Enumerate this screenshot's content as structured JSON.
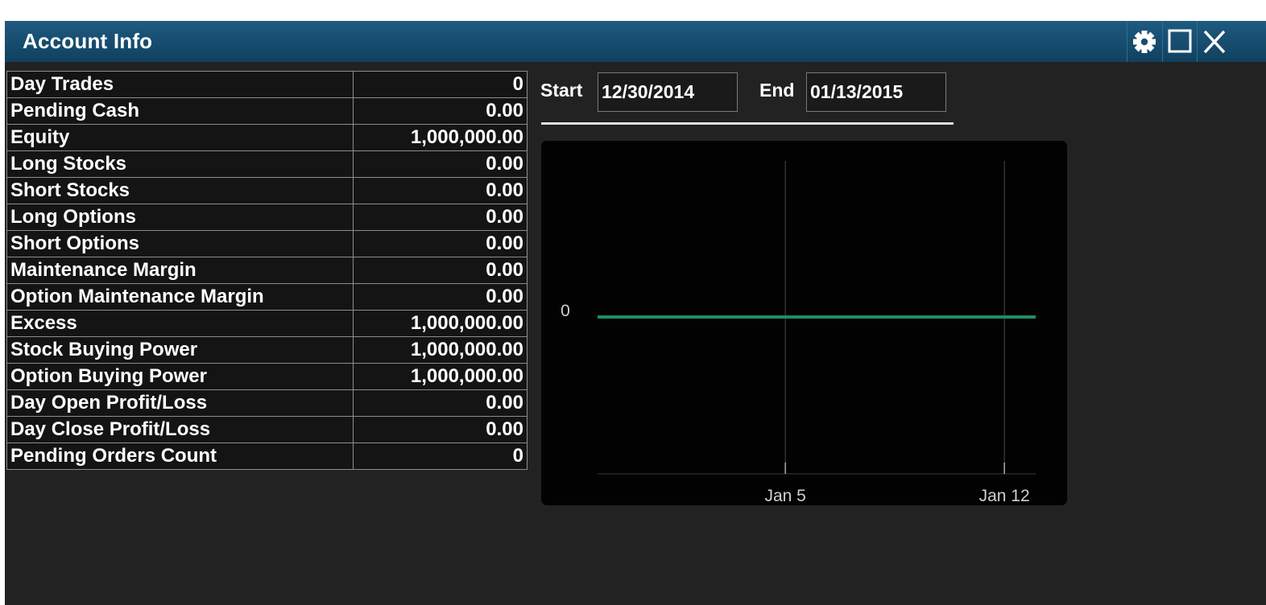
{
  "window": {
    "title": "Account Info",
    "controls": [
      {
        "name": "settings-gear-icon",
        "icon": "gear"
      },
      {
        "name": "maximize-icon",
        "icon": "square"
      },
      {
        "name": "close-icon",
        "icon": "x"
      }
    ]
  },
  "account_rows": [
    {
      "label": "Day Trades",
      "value": "0"
    },
    {
      "label": "Pending Cash",
      "value": "0.00"
    },
    {
      "label": "Equity",
      "value": "1,000,000.00"
    },
    {
      "label": "Long Stocks",
      "value": "0.00"
    },
    {
      "label": "Short Stocks",
      "value": "0.00"
    },
    {
      "label": "Long Options",
      "value": "0.00"
    },
    {
      "label": "Short Options",
      "value": "0.00"
    },
    {
      "label": "Maintenance Margin",
      "value": "0.00"
    },
    {
      "label": "Option Maintenance Margin",
      "value": "0.00"
    },
    {
      "label": "Excess",
      "value": "1,000,000.00"
    },
    {
      "label": "Stock Buying Power",
      "value": "1,000,000.00"
    },
    {
      "label": "Option Buying Power",
      "value": "1,000,000.00"
    },
    {
      "label": "Day Open Profit/Loss",
      "value": "0.00"
    },
    {
      "label": "Day Close Profit/Loss",
      "value": "0.00"
    },
    {
      "label": "Pending Orders Count",
      "value": "0"
    }
  ],
  "date_range": {
    "start_label": "Start",
    "start_value": "12/30/2014",
    "end_label": "End",
    "end_value": "01/13/2015"
  },
  "colors": {
    "titlebar": "#16506f",
    "line": "#1d8c6c",
    "background": "#222222"
  },
  "chart_data": {
    "type": "line",
    "x": [
      "2014-12-30",
      "2015-01-13"
    ],
    "series": [
      {
        "values": [
          0,
          0
        ]
      }
    ],
    "xticks": [
      "Jan 5",
      "Jan 12"
    ],
    "yticks": [
      "0"
    ],
    "grid": "vertical"
  }
}
